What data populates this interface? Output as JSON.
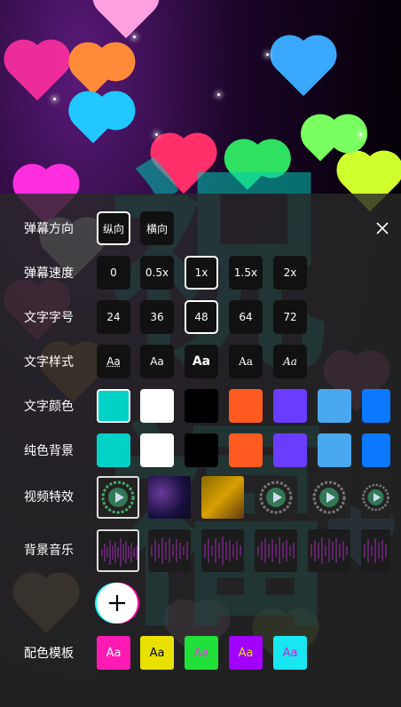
{
  "panel": {
    "rows": {
      "direction": {
        "label": "弹幕方向",
        "options": [
          "纵向",
          "横向"
        ],
        "selected": 0
      },
      "speed": {
        "label": "弹幕速度",
        "options": [
          "0",
          "0.5x",
          "1x",
          "1.5x",
          "2x"
        ],
        "selected": 2
      },
      "font_size": {
        "label": "文字字号",
        "options": [
          "24",
          "36",
          "48",
          "64",
          "72"
        ],
        "selected": 2
      },
      "font_style": {
        "label": "文字样式",
        "options": [
          "Aa",
          "Aa",
          "Aa",
          "Aa",
          "Aa"
        ]
      },
      "text_color": {
        "label": "文字颜色",
        "colors": [
          "#00d2c8",
          "#ffffff",
          "#000000",
          "#ff5a1f",
          "#6a3cff",
          "#4aa8ee",
          "#0a78ff"
        ],
        "selected": 0
      },
      "bg_color": {
        "label": "纯色背景",
        "colors": [
          "#00d2c8",
          "#ffffff",
          "#000000",
          "#ff5a1f",
          "#6a3cff",
          "#4aa8ee",
          "#0a78ff"
        ]
      },
      "video_effect": {
        "label": "视频特效"
      },
      "bg_music": {
        "label": "背景音乐"
      },
      "template": {
        "label": "配色模板",
        "items": [
          {
            "text": "Aa",
            "bg": "#ff1bb3",
            "fg": "#ffffff"
          },
          {
            "text": "Aa",
            "bg": "#e8e100",
            "fg": "#000000"
          },
          {
            "text": "Aa",
            "bg": "#22e03a",
            "fg": "#e040e0"
          },
          {
            "text": "Aa",
            "bg": "#a100ff",
            "fg": "#e0e000"
          },
          {
            "text": "Aa",
            "bg": "#18e6f0",
            "fg": "#d020d0"
          }
        ]
      }
    }
  },
  "background_text": [
    "祝",
    "福"
  ]
}
